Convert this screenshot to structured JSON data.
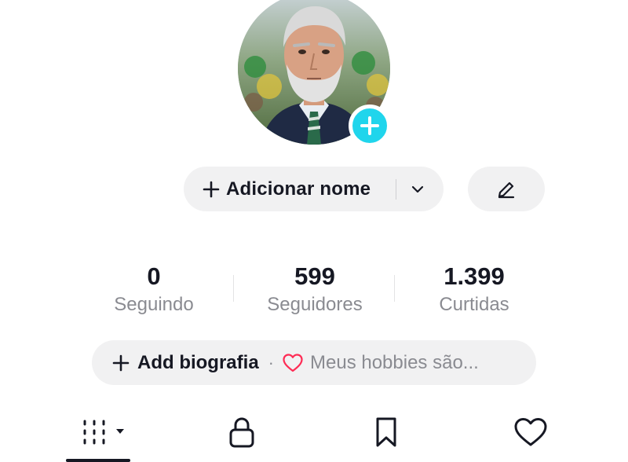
{
  "profile": {
    "add_name_label": "Adicionar nome",
    "avatar_icon": "profile-photo",
    "avatar_add_icon": "plus-icon",
    "accent_color": "#20d5ec"
  },
  "stats": {
    "following": {
      "value": "0",
      "caption": "Seguindo"
    },
    "followers": {
      "value": "599",
      "caption": "Seguidores"
    },
    "likes": {
      "value": "1.399",
      "caption": "Curtidas"
    }
  },
  "bio": {
    "add_label": "Add biografia",
    "separator": "·",
    "hint": "Meus hobbies são...",
    "heart_color": "#fe2c55"
  },
  "tabs": [
    {
      "icon": "grid-icon",
      "active": true
    },
    {
      "icon": "lock-icon",
      "active": false
    },
    {
      "icon": "bookmark-icon",
      "active": false
    },
    {
      "icon": "heart-icon",
      "active": false
    }
  ]
}
